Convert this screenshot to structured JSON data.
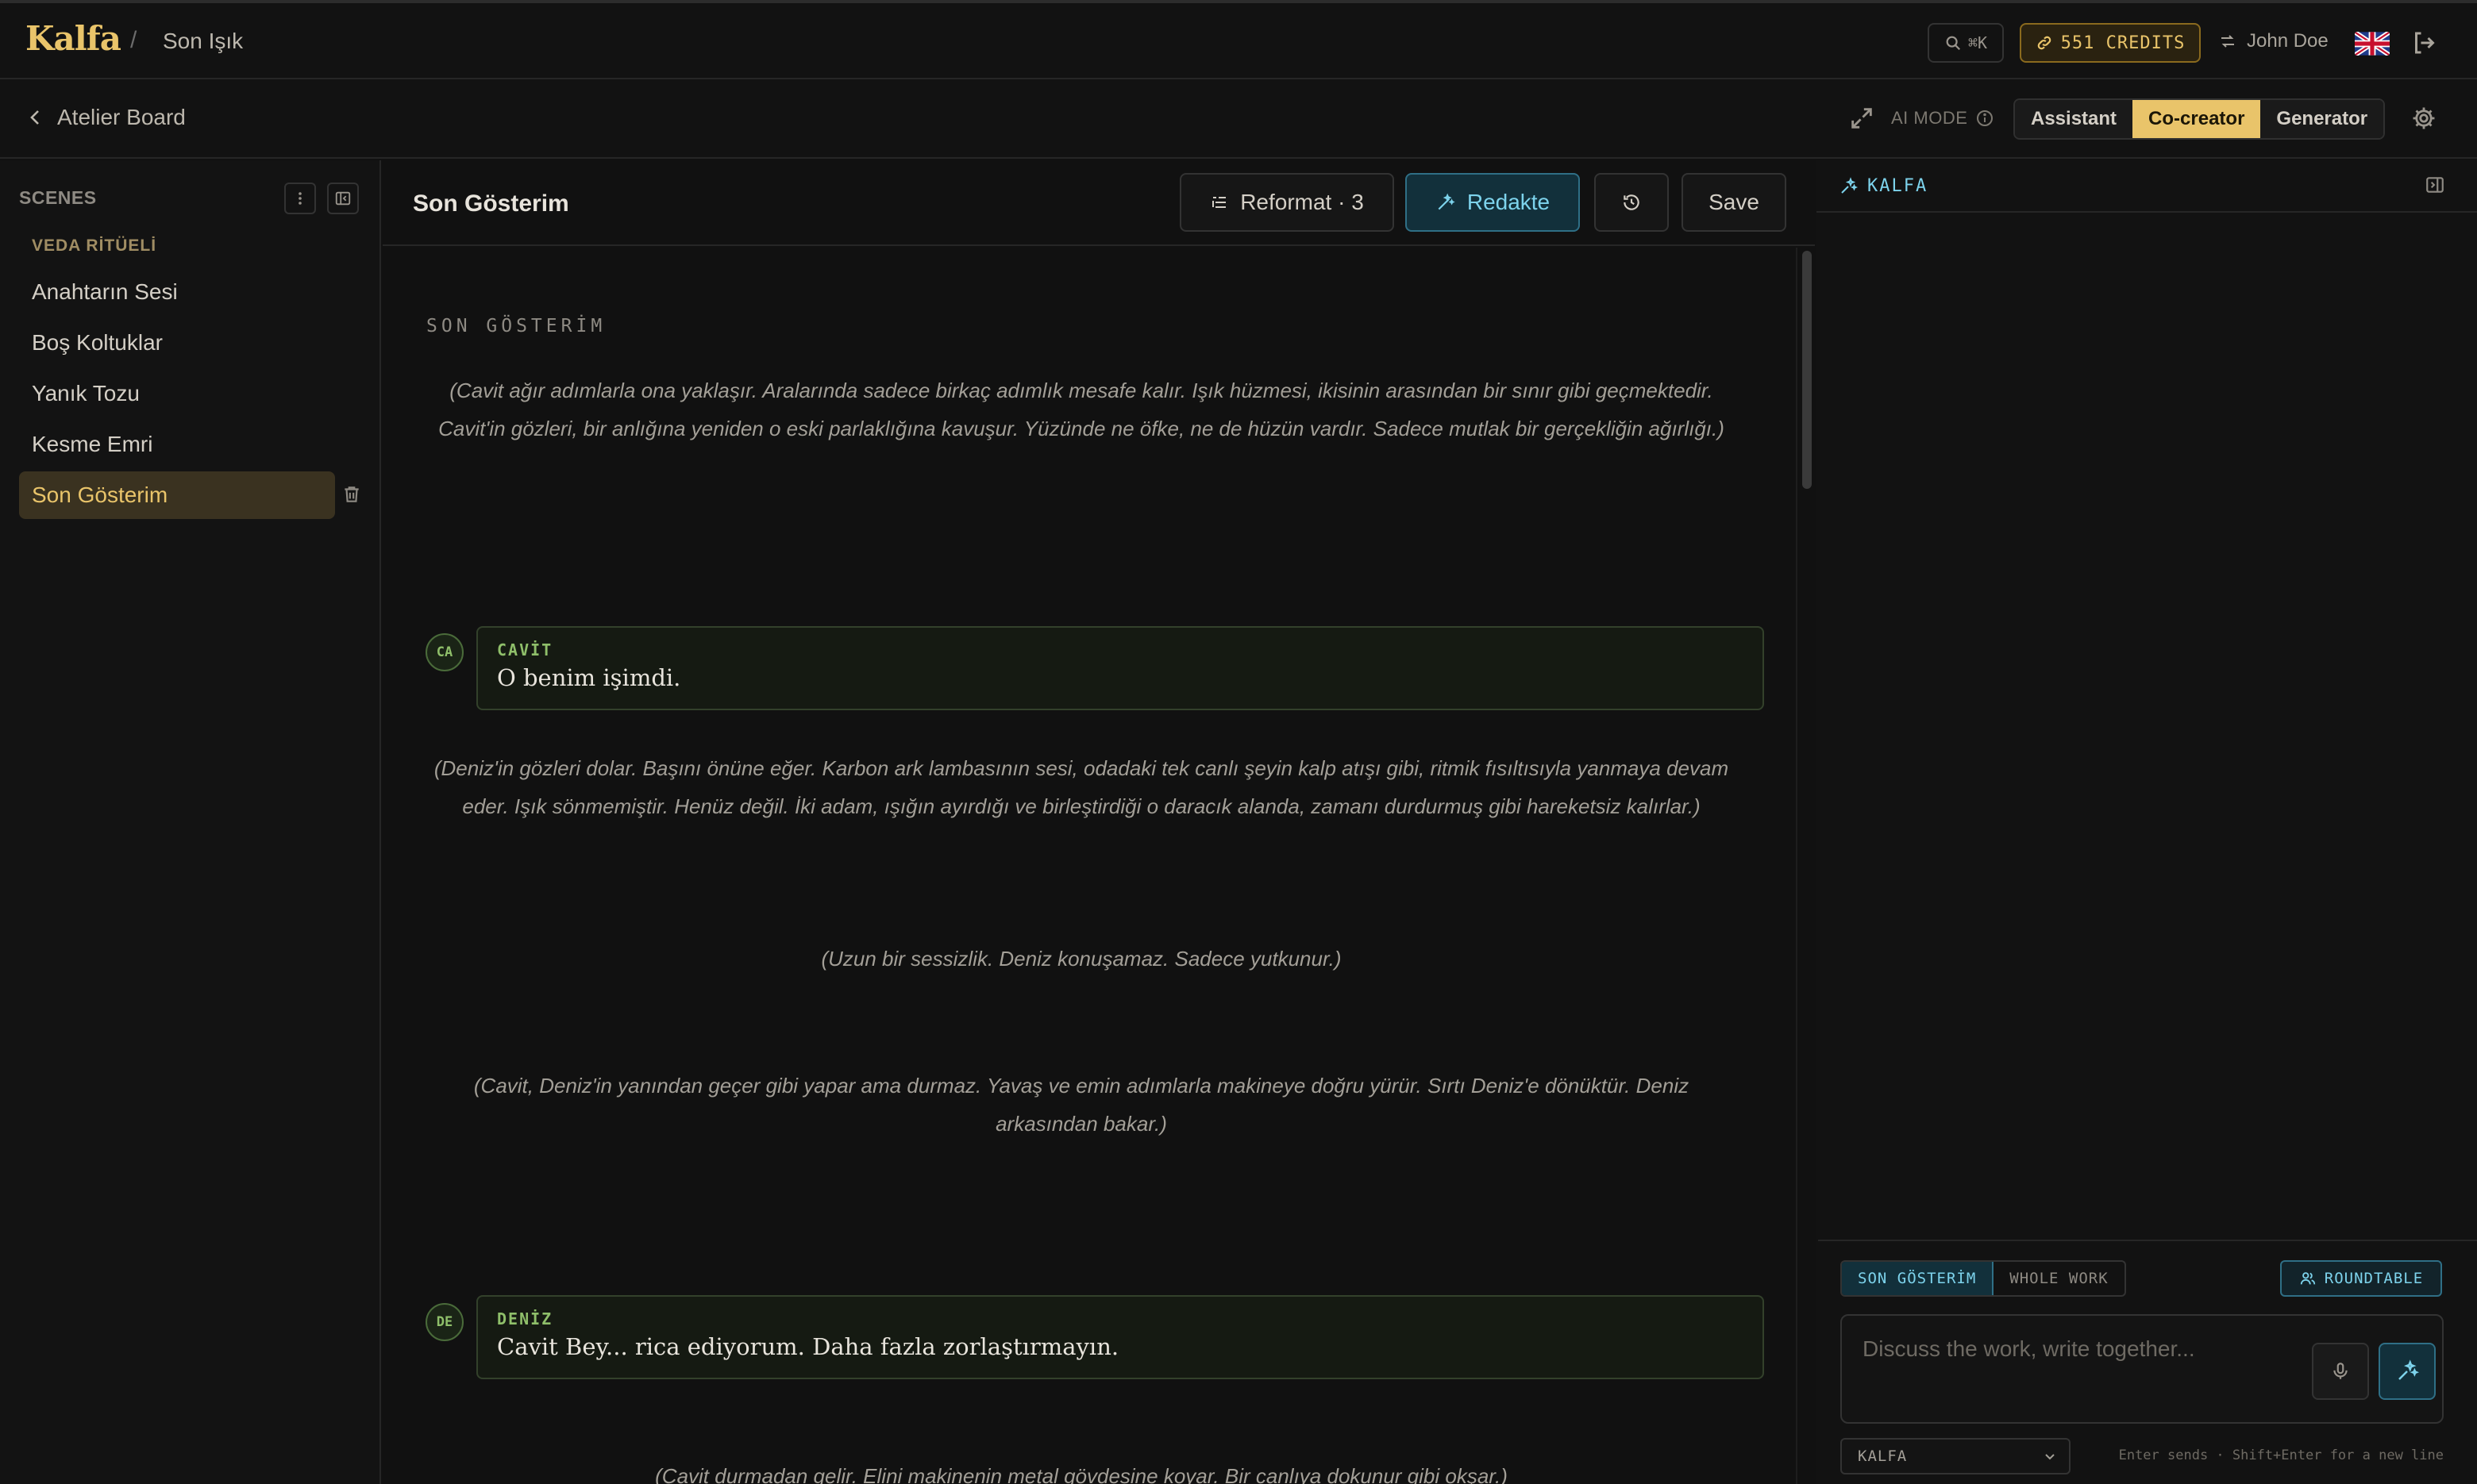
{
  "app": {
    "brand": "Kalfa",
    "breadcrumb_sep": "/",
    "project": "Son Işık"
  },
  "topbar": {
    "search_shortcut": "⌘K",
    "credits": "551 CREDITS",
    "user": "John Doe"
  },
  "subbar": {
    "back_label": "Atelier Board",
    "ai_mode_label": "AI MODE",
    "modes": [
      "Assistant",
      "Co-creator",
      "Generator"
    ],
    "active_mode": "Co-creator"
  },
  "sidebar": {
    "title": "SCENES",
    "group": "VEDA RİTÜELİ",
    "scenes": [
      "Anahtarın Sesi",
      "Boş Koltuklar",
      "Yanık Tozu",
      "Kesme Emri",
      "Son Gösterim"
    ],
    "active_scene": "Son Gösterim"
  },
  "editor": {
    "title": "Son Gösterim",
    "reformat_label": "Reformat · 3",
    "redakte_label": "Redakte",
    "save_label": "Save",
    "scene_heading": "SON GÖSTERİM",
    "blocks": [
      {
        "type": "action",
        "text": "(Cavit ağır adımlarla ona yaklaşır. Aralarında sadece birkaç adımlık mesafe kalır. Işık hüzmesi, ikisinin arasından bir sınır gibi geçmektedir. Cavit'in gözleri, bir anlığına yeniden o eski parlaklığına kavuşur. Yüzünde ne öfke, ne de hüzün vardır. Sadece mutlak bir gerçekliğin ağırlığı.)"
      },
      {
        "type": "dialogue",
        "initials": "CA",
        "character": "CAVİT",
        "line": "O benim işimdi."
      },
      {
        "type": "action",
        "text": "(Deniz'in gözleri dolar. Başını önüne eğer. Karbon ark lambasının sesi, odadaki tek canlı şeyin kalp atışı gibi, ritmik fısıltısıyla yanmaya devam eder. Işık sönmemiştir. Henüz değil. İki adam, ışığın ayırdığı ve birleştirdiği o daracık alanda, zamanı durdurmuş gibi hareketsiz kalırlar.)"
      },
      {
        "type": "action",
        "text": "(Uzun bir sessizlik. Deniz konuşamaz. Sadece yutkunur.)"
      },
      {
        "type": "action",
        "text": "(Cavit, Deniz'in yanından geçer gibi yapar ama durmaz. Yavaş ve emin adımlarla makineye doğru yürür. Sırtı Deniz'e dönüktür. Deniz arkasından bakar.)"
      },
      {
        "type": "dialogue",
        "initials": "DE",
        "character": "DENİZ",
        "line": "Cavit Bey... rica ediyorum. Daha fazla zorlaştırmayın."
      },
      {
        "type": "action",
        "text": "(Cavit durmadan gelir. Elini makinenin metal gövdesine koyar. Bir canlıya dokunur gibi okşar.)"
      }
    ]
  },
  "panel": {
    "title": "KALFA",
    "scope_options": [
      "SON GÖSTERİM",
      "WHOLE WORK"
    ],
    "active_scope": "SON GÖSTERİM",
    "roundtable_label": "ROUNDTABLE",
    "composer_placeholder": "Discuss the work, write together...",
    "model": "KALFA",
    "hint": "Enter sends · Shift+Enter for a new line"
  },
  "colors": {
    "accent_gold": "#e9c46a",
    "accent_cyan": "#7dd3ec",
    "dialogue_green": "#8fbf6a"
  }
}
